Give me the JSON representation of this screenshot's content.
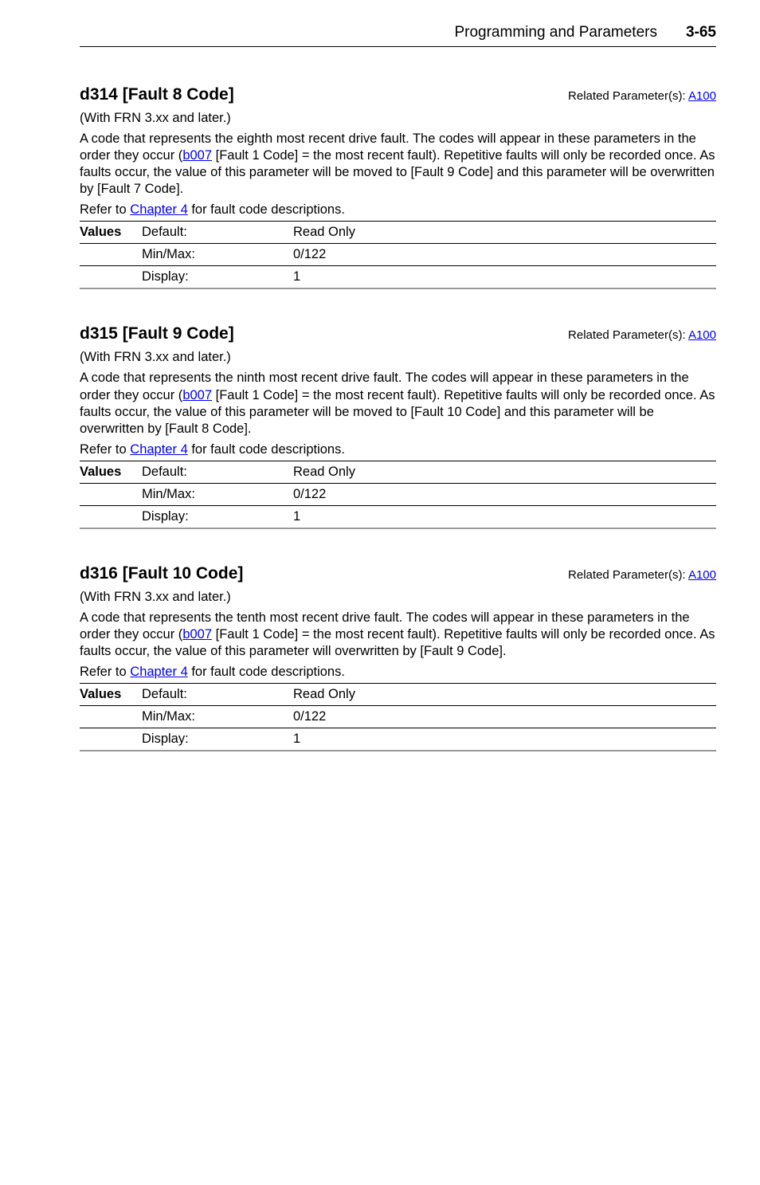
{
  "header": {
    "title": "Programming and Parameters",
    "pageNum": "3-65"
  },
  "sections": [
    {
      "title": "d314 [Fault 8 Code]",
      "relatedPrefix": "Related Parameter(s): ",
      "relatedLink": "A100",
      "subtitle": "(With FRN 3.xx and later.)",
      "descPre": "A code that represents the eighth most recent drive fault. The codes will appear in these parameters in the order they occur (",
      "descLink": "b007",
      "descPost": " [Fault 1 Code] = the most recent fault). Repetitive faults will only be recorded once. As faults occur, the value of this parameter will be moved to [Fault 9 Code] and this parameter will be overwritten by [Fault 7 Code].",
      "referPre": "Refer to ",
      "referLink": "Chapter 4",
      "referPost": " for fault code descriptions.",
      "valuesLabel": "Values",
      "rows": [
        {
          "field": "Default:",
          "value": "Read Only"
        },
        {
          "field": "Min/Max:",
          "value": "0/122"
        },
        {
          "field": "Display:",
          "value": "1"
        }
      ]
    },
    {
      "title": "d315 [Fault 9 Code]",
      "relatedPrefix": "Related Parameter(s): ",
      "relatedLink": "A100",
      "subtitle": "(With FRN 3.xx and later.)",
      "descPre": "A code that represents the ninth most recent drive fault. The codes will appear in these parameters in the order they occur (",
      "descLink": "b007",
      "descPost": " [Fault 1 Code] = the most recent fault). Repetitive faults will only be recorded once. As faults occur, the value of this parameter will be moved to [Fault 10 Code] and this parameter will be overwritten by [Fault 8 Code].",
      "referPre": "Refer to ",
      "referLink": "Chapter 4",
      "referPost": " for fault code descriptions.",
      "valuesLabel": "Values",
      "rows": [
        {
          "field": "Default:",
          "value": "Read Only"
        },
        {
          "field": "Min/Max:",
          "value": "0/122"
        },
        {
          "field": "Display:",
          "value": "1"
        }
      ]
    },
    {
      "title": "d316 [Fault 10 Code]",
      "relatedPrefix": "Related Parameter(s): ",
      "relatedLink": "A100",
      "subtitle": "(With FRN 3.xx and later.)",
      "descPre": "A code that represents the tenth most recent drive fault. The codes will appear in these parameters in the order they occur (",
      "descLink": "b007",
      "descPost": " [Fault 1 Code] = the most recent fault). Repetitive faults will only be recorded once. As faults occur, the value of this parameter will overwritten by [Fault 9 Code].",
      "referPre": "Refer to ",
      "referLink": "Chapter 4",
      "referPost": " for fault code descriptions.",
      "valuesLabel": "Values",
      "rows": [
        {
          "field": "Default:",
          "value": "Read Only"
        },
        {
          "field": "Min/Max:",
          "value": "0/122"
        },
        {
          "field": "Display:",
          "value": "1"
        }
      ]
    }
  ]
}
